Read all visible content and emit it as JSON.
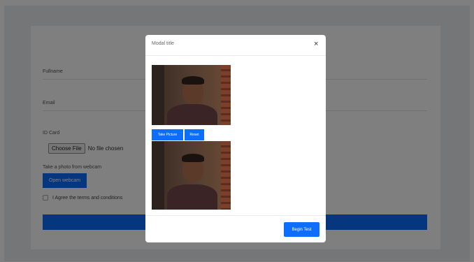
{
  "form": {
    "fullname_label": "Fullname",
    "email_label": "Email",
    "id_card_label": "ID Card",
    "choose_file_label": "Choose File",
    "file_status": "No file chosen",
    "webcam_section_label": "Take a photo from webcam",
    "open_webcam_label": "Open webcam",
    "agree_label": "I Agree the terms and conditions",
    "begin_test_label": "Begin Test"
  },
  "modal": {
    "title": "Modal title",
    "close_glyph": "×",
    "take_picture_label": "Take Picture",
    "reset_label": "Reset",
    "begin_test_label": "Begin Test"
  },
  "colors": {
    "primary": "#0d6efd",
    "backdrop": "rgba(0,0,0,0.5)"
  },
  "icons": {
    "close": "close-icon"
  }
}
